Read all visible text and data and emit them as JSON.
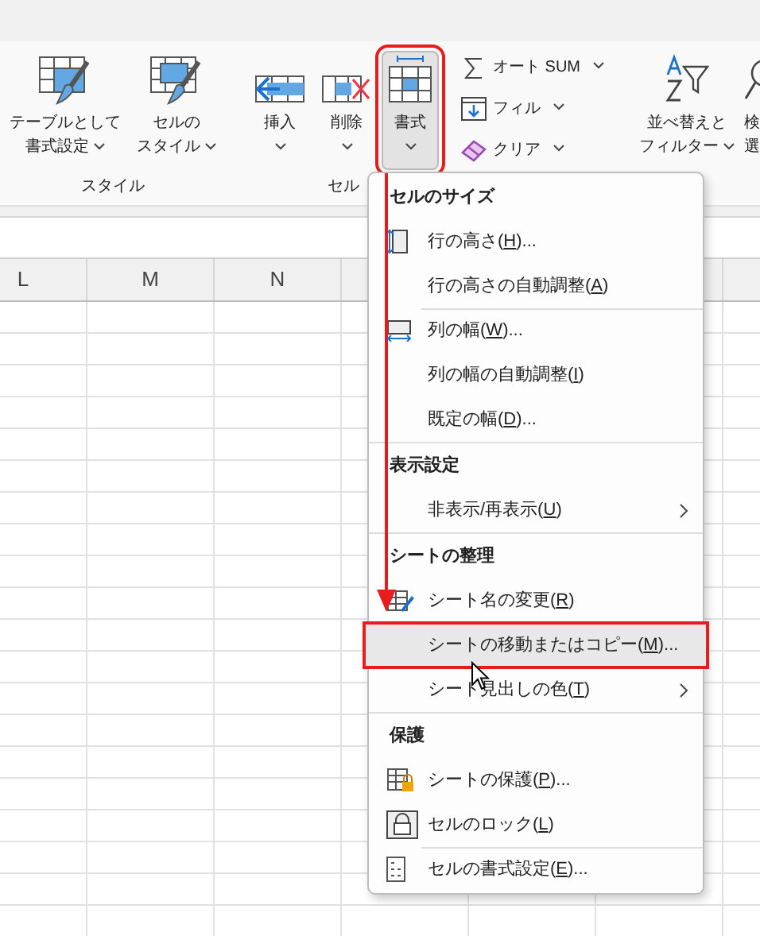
{
  "ribbon": {
    "groups": [
      {
        "label": "スタイル",
        "buttons": [
          {
            "lines": [
              "テーブルとして",
              "書式設定"
            ],
            "dropdown": true,
            "pressed": false
          },
          {
            "lines": [
              "セルの",
              "スタイル"
            ],
            "dropdown": true,
            "pressed": false
          }
        ]
      },
      {
        "label": "セル",
        "buttons": [
          {
            "lines": [
              "挿入"
            ],
            "dropdown": true,
            "pressed": false
          },
          {
            "lines": [
              "削除"
            ],
            "dropdown": true,
            "pressed": false
          },
          {
            "lines": [
              "書式"
            ],
            "dropdown": true,
            "pressed": true
          }
        ]
      }
    ],
    "editing": {
      "small_buttons": [
        {
          "label": "オート SUM",
          "dropdown": true
        },
        {
          "label": "フィル",
          "dropdown": true
        },
        {
          "label": "クリア",
          "dropdown": true
        }
      ],
      "sort_button": {
        "lines": [
          "並べ替えと",
          "フィルター"
        ],
        "dropdown": true
      },
      "find_button": {
        "lines": [
          "検",
          "選"
        ]
      }
    }
  },
  "sheet": {
    "columns": [
      "L",
      "M",
      "N"
    ]
  },
  "menu": {
    "items": [
      {
        "kind": "header",
        "label": "セルのサイズ"
      },
      {
        "kind": "item",
        "text_before": "行の高さ(",
        "access_key": "H",
        "text_after": ")...",
        "highlighted": false,
        "submenu": false,
        "divider_above": false
      },
      {
        "kind": "item",
        "text_before": "行の高さの自動調整(",
        "access_key": "A",
        "text_after": ")",
        "highlighted": false,
        "submenu": false,
        "divider_above": false
      },
      {
        "kind": "item",
        "text_before": "列の幅(",
        "access_key": "W",
        "text_after": ")...",
        "highlighted": false,
        "submenu": false,
        "divider_above": true
      },
      {
        "kind": "item",
        "text_before": "列の幅の自動調整(",
        "access_key": "I",
        "text_after": ")",
        "highlighted": false,
        "submenu": false,
        "divider_above": false
      },
      {
        "kind": "item",
        "text_before": "既定の幅(",
        "access_key": "D",
        "text_after": ")...",
        "highlighted": false,
        "submenu": false,
        "divider_above": false
      },
      {
        "kind": "header",
        "label": "表示設定"
      },
      {
        "kind": "item",
        "text_before": "非表示/再表示(",
        "access_key": "U",
        "text_after": ")",
        "highlighted": false,
        "submenu": true,
        "divider_above": false
      },
      {
        "kind": "header",
        "label": "シートの整理"
      },
      {
        "kind": "item",
        "text_before": "シート名の変更(",
        "access_key": "R",
        "text_after": ")",
        "highlighted": false,
        "submenu": false,
        "divider_above": false
      },
      {
        "kind": "item",
        "text_before": "シートの移動またはコピー(",
        "access_key": "M",
        "text_after": ")...",
        "highlighted": true,
        "submenu": false,
        "divider_above": false
      },
      {
        "kind": "item",
        "text_before": "シート見出しの色(",
        "access_key": "T",
        "text_after": ")",
        "highlighted": false,
        "submenu": true,
        "divider_above": false
      },
      {
        "kind": "header",
        "label": "保護"
      },
      {
        "kind": "item",
        "text_before": "シートの保護(",
        "access_key": "P",
        "text_after": ")...",
        "highlighted": false,
        "submenu": false,
        "divider_above": false
      },
      {
        "kind": "item",
        "text_before": "セルのロック(",
        "access_key": "L",
        "text_after": ")",
        "highlighted": false,
        "submenu": false,
        "divider_above": false
      },
      {
        "kind": "item",
        "text_before": "セルの書式設定(",
        "access_key": "E",
        "text_after": ")...",
        "highlighted": false,
        "submenu": false,
        "divider_above": true
      }
    ]
  }
}
